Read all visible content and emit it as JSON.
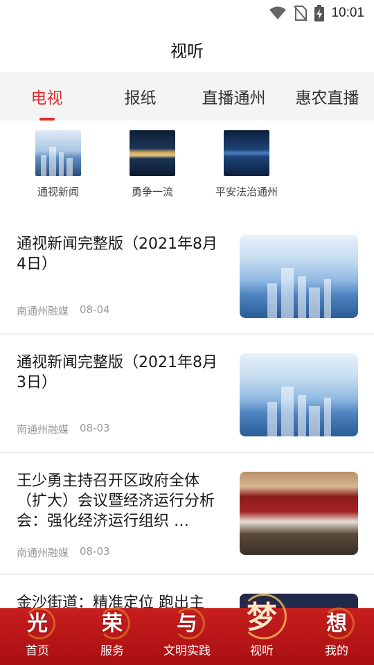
{
  "status_bar": {
    "time": "10:01",
    "icons": [
      "wifi-icon",
      "no-sim-icon",
      "battery-charging-icon"
    ]
  },
  "header": {
    "title": "视听"
  },
  "tabs": [
    {
      "label": "电视",
      "active": true
    },
    {
      "label": "报纸",
      "active": false
    },
    {
      "label": "直播通州",
      "active": false
    },
    {
      "label": "惠农直播",
      "active": false
    }
  ],
  "channels": [
    {
      "label": "通视新闻"
    },
    {
      "label": "勇争一流"
    },
    {
      "label": "平安法治通州"
    }
  ],
  "news": [
    {
      "headline": "通视新闻完整版（2021年8月4日）",
      "source": "南通州融媒",
      "date": "08-04"
    },
    {
      "headline": "通视新闻完整版（2021年8月3日）",
      "source": "南通州融媒",
      "date": "08-03"
    },
    {
      "headline": "王少勇主持召开区政府全体（扩大）会议暨经济运行分析会：强化经济运行组织 …",
      "source": "南通州融媒",
      "date": "08-03"
    },
    {
      "headline": "金沙街道：精准定位 跑出主"
    }
  ],
  "bottom_nav": [
    {
      "glyph": "光",
      "label": "首页",
      "active": false
    },
    {
      "glyph": "荣",
      "label": "服务",
      "active": false
    },
    {
      "glyph": "与",
      "label": "文明实践",
      "active": false
    },
    {
      "glyph": "梦",
      "label": "视听",
      "active": true
    },
    {
      "glyph": "想",
      "label": "我的",
      "active": false
    }
  ],
  "colors": {
    "accent": "#e02c2c",
    "nav_background": "#b8161a"
  }
}
